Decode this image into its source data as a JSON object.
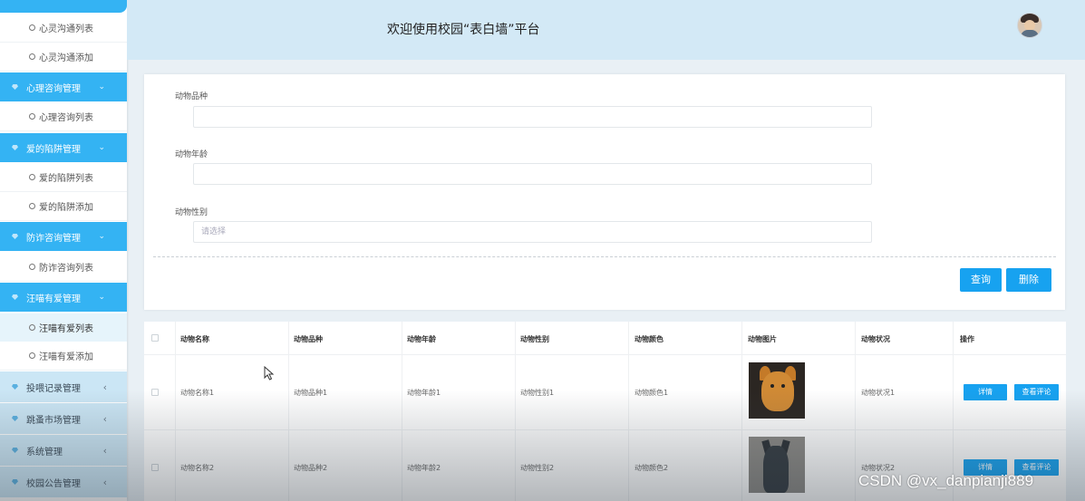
{
  "sidebar": {
    "top_cut": "",
    "items": [
      {
        "label": "心灵沟通列表"
      },
      {
        "label": "心灵沟通添加"
      },
      {
        "label": "心理咨询管理"
      },
      {
        "label": "心理咨询列表"
      },
      {
        "label": "爱的陷阱管理"
      },
      {
        "label": "爱的陷阱列表"
      },
      {
        "label": "爱的陷阱添加"
      },
      {
        "label": "防诈咨询管理"
      },
      {
        "label": "防诈咨询列表"
      },
      {
        "label": "汪喵有爱管理"
      },
      {
        "label": "汪喵有爱列表"
      },
      {
        "label": "汪喵有爱添加"
      },
      {
        "label": "投喂记录管理"
      },
      {
        "label": "跳蚤市场管理"
      },
      {
        "label": "系统管理"
      },
      {
        "label": "校园公告管理"
      }
    ],
    "chevron_open": "⌄",
    "chevron_closed": "‹"
  },
  "header": {
    "title": "欢迎使用校园“表白墙”平台"
  },
  "search": {
    "breed_label": "动物品种",
    "age_label": "动物年龄",
    "gender_label": "动物性别",
    "gender_placeholder": "请选择",
    "query_button": "查询",
    "delete_button": "删除"
  },
  "table": {
    "headers": [
      "动物名称",
      "动物品种",
      "动物年龄",
      "动物性别",
      "动物颜色",
      "动物图片",
      "动物状况",
      "操作"
    ],
    "rows": [
      {
        "name": "动物名称1",
        "breed": "动物品种1",
        "age": "动物年龄1",
        "gender": "动物性别1",
        "color": "动物颜色1",
        "status": "动物状况1",
        "detail": "详情",
        "comments": "查看评论"
      },
      {
        "name": "动物名称2",
        "breed": "动物品种2",
        "age": "动物年龄2",
        "gender": "动物性别2",
        "color": "动物颜色2",
        "status": "动物状况2",
        "detail": "详情",
        "comments": "查看评论"
      }
    ]
  },
  "watermark": "CSDN @vx_danpianji889",
  "colors": {
    "accent": "#17a2f0",
    "sidebar_active": "#34b3f3",
    "header_bg": "#d3e9f6"
  }
}
